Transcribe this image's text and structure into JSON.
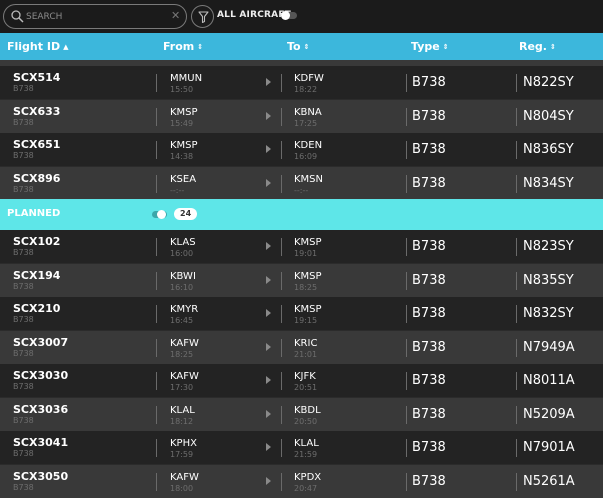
{
  "toolbar": {
    "search_placeholder": "SEARCH",
    "search_icon": "search-icon",
    "clear_icon": "close-icon",
    "clear_glyph": "✕",
    "filter_icon": "filter-icon",
    "all_aircraft_label": "ALL AIRCRAFT",
    "all_aircraft_on": false
  },
  "columns": {
    "flight": "Flight ID",
    "flight_sort": "▲",
    "from": "From",
    "to": "To",
    "type": "Type",
    "reg": "Reg.",
    "sort_glyph": "⇕"
  },
  "colors": {
    "header": "#3cb7dc",
    "section": "#5ee6e8",
    "row_dark": "#232323",
    "row_light": "#393939"
  },
  "active_flights": [
    {
      "flight_id": "SCX514",
      "subtype": "B738",
      "from": "MMUN",
      "from_time": "15:50",
      "to": "KDFW",
      "to_time": "18:22",
      "type": "B738",
      "reg": "N822SY"
    },
    {
      "flight_id": "SCX633",
      "subtype": "B738",
      "from": "KMSP",
      "from_time": "15:49",
      "to": "KBNA",
      "to_time": "17:25",
      "type": "B738",
      "reg": "N804SY"
    },
    {
      "flight_id": "SCX651",
      "subtype": "B738",
      "from": "KMSP",
      "from_time": "14:38",
      "to": "KDEN",
      "to_time": "16:09",
      "type": "B738",
      "reg": "N836SY"
    },
    {
      "flight_id": "SCX896",
      "subtype": "B738",
      "from": "KSEA",
      "from_time": "--:--",
      "to": "KMSN",
      "to_time": "--:--",
      "type": "B738",
      "reg": "N834SY"
    }
  ],
  "planned": {
    "title": "PLANNED",
    "count": "24",
    "toggle_on": true,
    "flights": [
      {
        "flight_id": "SCX102",
        "subtype": "B738",
        "from": "KLAS",
        "from_time": "16:00",
        "to": "KMSP",
        "to_time": "19:01",
        "type": "B738",
        "reg": "N823SY"
      },
      {
        "flight_id": "SCX194",
        "subtype": "B738",
        "from": "KBWI",
        "from_time": "16:10",
        "to": "KMSP",
        "to_time": "18:25",
        "type": "B738",
        "reg": "N835SY"
      },
      {
        "flight_id": "SCX210",
        "subtype": "B738",
        "from": "KMYR",
        "from_time": "16:45",
        "to": "KMSP",
        "to_time": "19:15",
        "type": "B738",
        "reg": "N832SY"
      },
      {
        "flight_id": "SCX3007",
        "subtype": "B738",
        "from": "KAFW",
        "from_time": "18:25",
        "to": "KRIC",
        "to_time": "21:01",
        "type": "B738",
        "reg": "N7949A"
      },
      {
        "flight_id": "SCX3030",
        "subtype": "B738",
        "from": "KAFW",
        "from_time": "17:30",
        "to": "KJFK",
        "to_time": "20:51",
        "type": "B738",
        "reg": "N8011A"
      },
      {
        "flight_id": "SCX3036",
        "subtype": "B738",
        "from": "KLAL",
        "from_time": "18:12",
        "to": "KBDL",
        "to_time": "20:50",
        "type": "B738",
        "reg": "N5209A"
      },
      {
        "flight_id": "SCX3041",
        "subtype": "B738",
        "from": "KPHX",
        "from_time": "17:59",
        "to": "KLAL",
        "to_time": "21:59",
        "type": "B738",
        "reg": "N7901A"
      },
      {
        "flight_id": "SCX3050",
        "subtype": "B738",
        "from": "KAFW",
        "from_time": "18:00",
        "to": "KPDX",
        "to_time": "20:47",
        "type": "B738",
        "reg": "N5261A"
      }
    ]
  }
}
